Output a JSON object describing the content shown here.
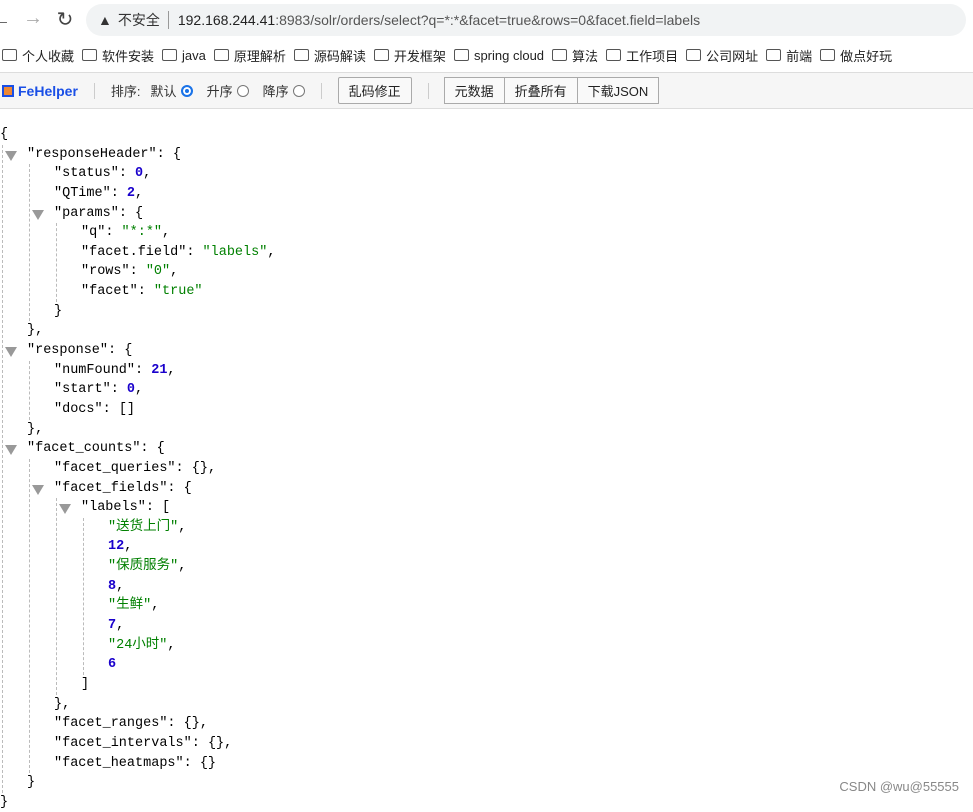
{
  "browser": {
    "security_label": "不安全",
    "url_host": "192.168.244.41",
    "url_rest": ":8983/solr/orders/select?q=*:*&facet=true&rows=0&facet.field=labels",
    "bookmarks": [
      "个人收藏",
      "软件安装",
      "java",
      "原理解析",
      "源码解读",
      "开发框架",
      "spring cloud",
      "算法",
      "工作项目",
      "公司网址",
      "前端",
      "做点好玩"
    ]
  },
  "fehelper": {
    "logo": "FeHelper",
    "sort_label": "排序:",
    "sort_options": [
      {
        "label": "默认",
        "selected": true
      },
      {
        "label": "升序",
        "selected": false
      },
      {
        "label": "降序",
        "selected": false
      }
    ],
    "fix_encoding": "乱码修正",
    "raw": "元数据",
    "collapse_all": "折叠所有",
    "download": "下载JSON"
  },
  "json_view": {
    "responseHeader": {
      "status": 0,
      "QTime": 2,
      "params": {
        "q": "*:*",
        "facet.field": "labels",
        "rows": "0",
        "facet": "true"
      }
    },
    "response": {
      "numFound": 21,
      "start": 0,
      "docs": []
    },
    "facet_counts": {
      "facet_queries": {},
      "facet_fields": {
        "labels": [
          "送货上门",
          12,
          "保质服务",
          8,
          "生鲜",
          7,
          "24小时",
          6
        ]
      },
      "facet_ranges": {},
      "facet_intervals": {},
      "facet_heatmaps": {}
    }
  },
  "colors": {
    "string": "#008000",
    "number": "#1a01cc",
    "link": "#1a4fe6"
  },
  "watermark": "CSDN @wu@55555"
}
